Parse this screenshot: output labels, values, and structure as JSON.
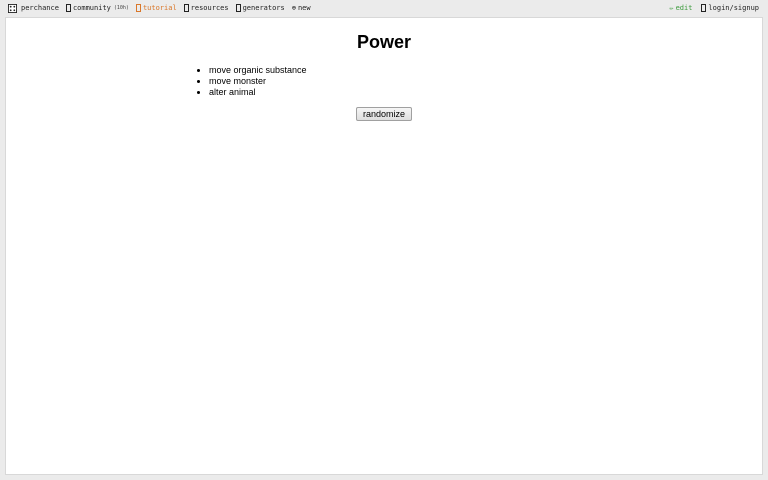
{
  "topbar": {
    "left": [
      {
        "name": "perchance",
        "label": "perchance",
        "icon": "dice-icon"
      },
      {
        "name": "community",
        "label": "community",
        "count": "(10h)",
        "icon": "chat-icon"
      },
      {
        "name": "tutorial",
        "label": "tutorial",
        "icon": "book-icon"
      },
      {
        "name": "resources",
        "label": "resources",
        "icon": "folder-icon"
      },
      {
        "name": "generators",
        "label": "generators",
        "icon": "grid-icon"
      },
      {
        "name": "new",
        "label": "new",
        "icon": "plus-circle-icon"
      }
    ],
    "right": [
      {
        "name": "edit",
        "label": "edit",
        "icon": "pencil-icon"
      },
      {
        "name": "login",
        "label": "login/signup",
        "icon": "user-icon"
      }
    ]
  },
  "colors": {
    "tutorial": "#d9772a",
    "edit": "#3d9b3d"
  },
  "main": {
    "title": "Power",
    "items": [
      "move organic substance",
      "move monster",
      "alter animal"
    ],
    "button_label": "randomize"
  }
}
